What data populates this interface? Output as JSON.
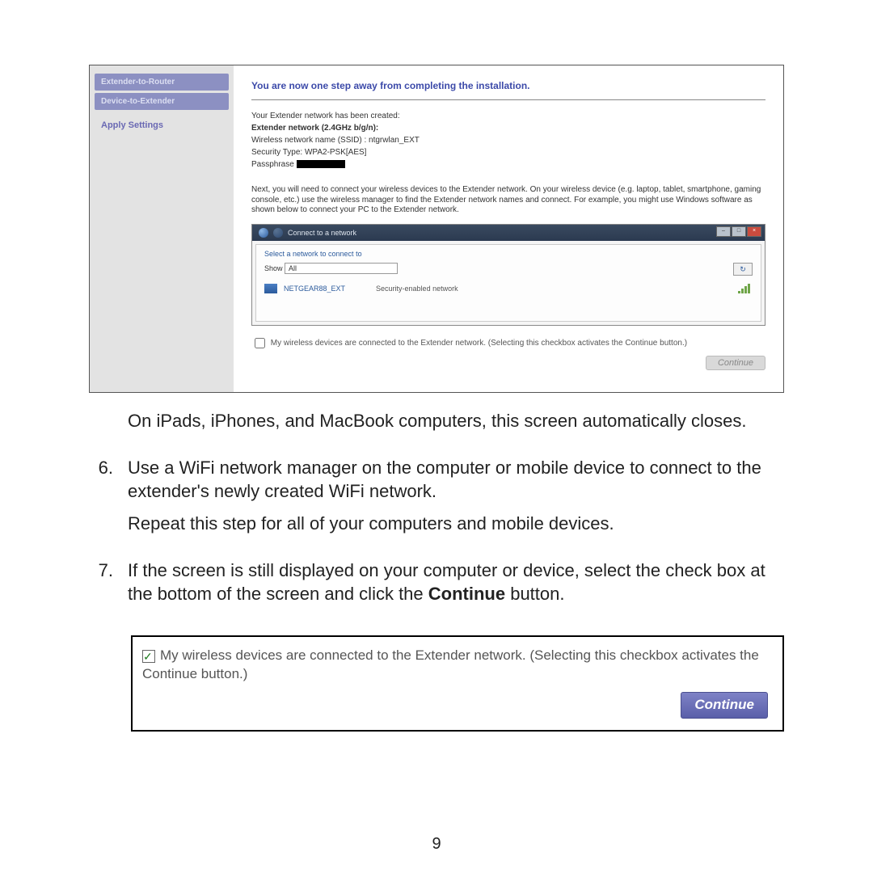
{
  "wizard": {
    "sidebar": {
      "item1": "Extender-to-Router",
      "item2": "Device-to-Extender",
      "item3": "Apply Settings"
    },
    "title": "You are now one step away from completing the installation.",
    "created": "Your Extender network has been created:",
    "band_label": "Extender network (2.4GHz b/g/n):",
    "ssid_line": "Wireless network name (SSID) : ntgrwlan_EXT",
    "sec_line": "Security Type: WPA2-PSK[AES]",
    "pass_label": "Passphrase",
    "instr": "Next, you will need to connect your wireless devices to the Extender network. On your wireless device (e.g. laptop, tablet, smartphone, gaming console, etc.) use the wireless manager to find the Extender network names and connect. For example, you might use Windows software as shown below to connect your PC to the Extender network.",
    "connect_window": {
      "title": "Connect to a network",
      "select_label": "Select a network to connect to",
      "show_label": "Show",
      "show_value": "All",
      "refresh": "↻",
      "network_name": "NETGEAR88_EXT",
      "network_desc": "Security-enabled network"
    },
    "foot_checkbox": "My wireless devices are connected to the Extender network. (Selecting this checkbox activates the Continue button.)",
    "continue_btn": "Continue"
  },
  "doc": {
    "after_shot": "On iPads, iPhones, and MacBook computers, this screen automatically closes.",
    "step6_num": "6.",
    "step6_a": "Use a WiFi network manager on the computer or mobile device to connect to the extender's newly created WiFi network.",
    "step6_b": "Repeat this step for all of your computers and mobile devices.",
    "step7_num": "7.",
    "step7_a_pre": "If the screen is still displayed on your computer or device, select the check box at the bottom of the screen and click the ",
    "step7_a_bold": "Continue",
    "step7_a_post": " button."
  },
  "zoom": {
    "text": "My wireless devices are connected to the Extender network. (Selecting this checkbox activates the Continue button.)",
    "btn": "Continue"
  },
  "page_number": "9"
}
